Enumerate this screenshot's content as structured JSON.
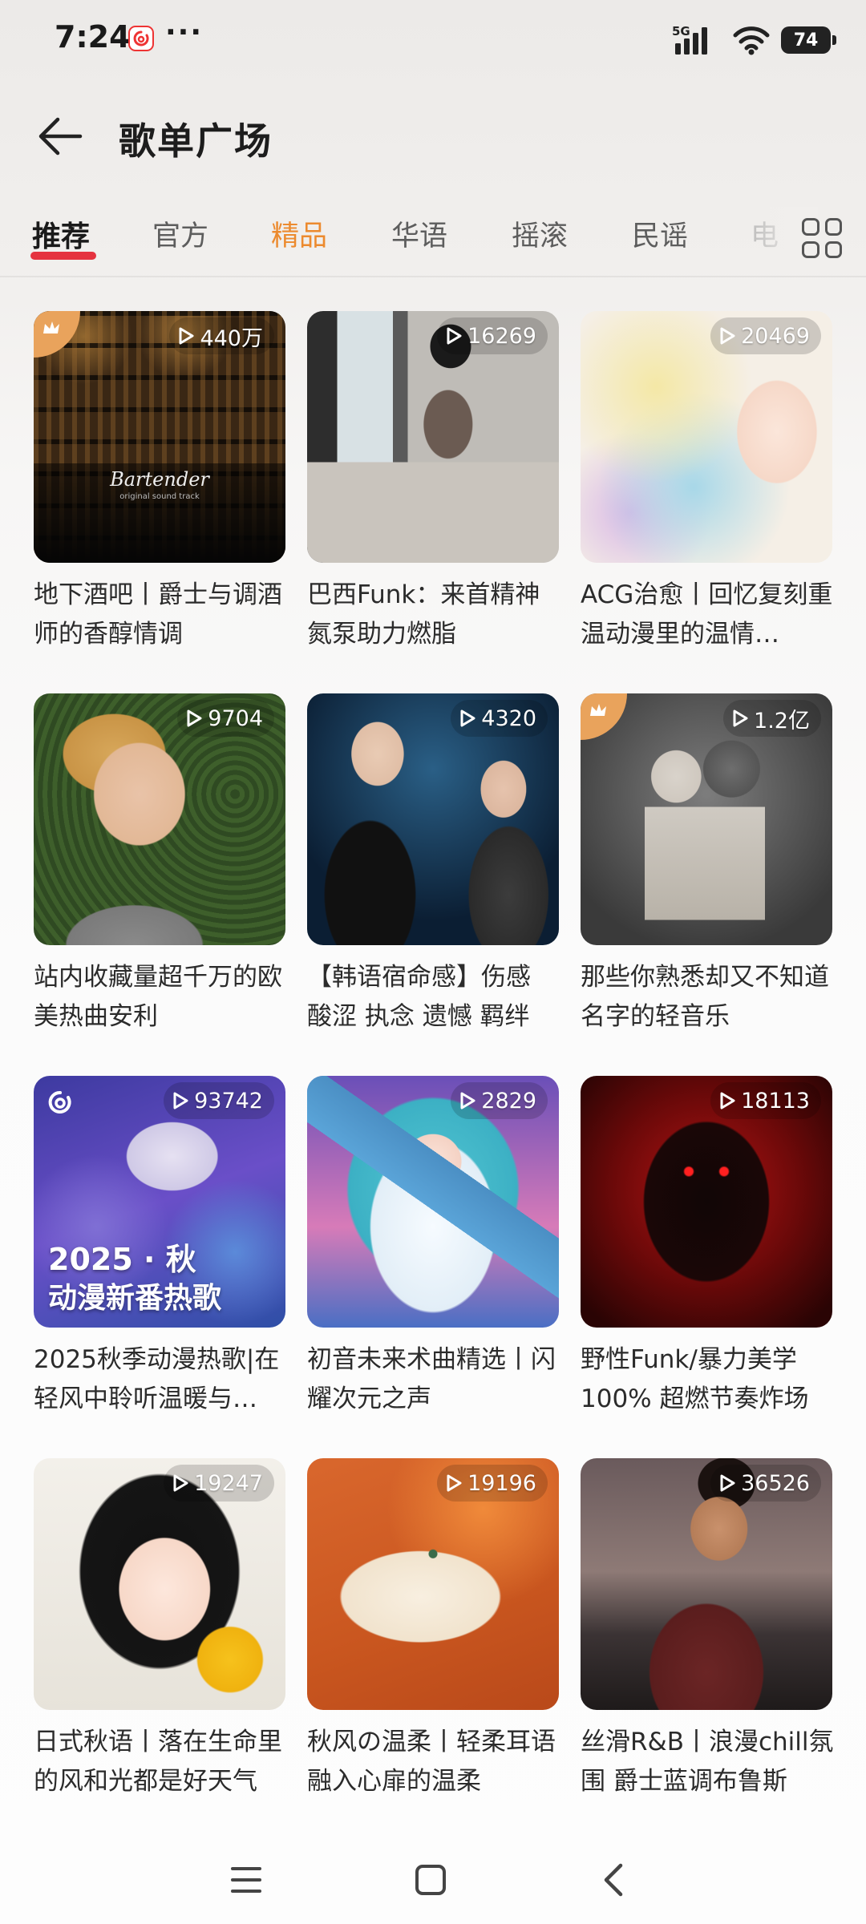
{
  "status_bar": {
    "time": "7:24",
    "more": "···",
    "network": "5G",
    "battery": "74"
  },
  "header": {
    "title": "歌单广场",
    "back_icon": "arrow-left-icon"
  },
  "tabs": [
    {
      "label": "推荐",
      "state": "selected"
    },
    {
      "label": "官方",
      "state": "normal"
    },
    {
      "label": "精品",
      "state": "highlighted"
    },
    {
      "label": "华语",
      "state": "normal"
    },
    {
      "label": "摇滚",
      "state": "normal"
    },
    {
      "label": "民谣",
      "state": "normal"
    },
    {
      "label": "电",
      "state": "faded"
    }
  ],
  "colors": {
    "accent_red": "#e5333f",
    "highlight_orange": "#ec8a2e",
    "badge_orange": "#e9a35c"
  },
  "playlists": [
    {
      "title": "地下酒吧丨爵士与调酒师的香醇情调",
      "play_count": "440万",
      "badge": "crown-icon",
      "cover_text": "Bartender",
      "cover_subtext": "original sound track"
    },
    {
      "title": "巴西Funk：来首精神氮泵助力燃脂",
      "play_count": "16269"
    },
    {
      "title": "ACG治愈丨回忆复刻重温动漫里的温情…",
      "play_count": "20469"
    },
    {
      "title": "站内收藏量超千万的欧美热曲安利",
      "play_count": "9704"
    },
    {
      "title": "【韩语宿命感】伤感 酸涩 执念 遗憾 羁绊",
      "play_count": "4320"
    },
    {
      "title": "那些你熟悉却又不知道名字的轻音乐",
      "play_count": "1.2亿",
      "badge": "crown-icon"
    },
    {
      "title": "2025秋季动漫热歌|在轻风中聆听温暖与…",
      "play_count": "93742",
      "badge": "netease-icon",
      "cover_text": "2025 · 秋",
      "cover_subtext": "动漫新番热歌"
    },
    {
      "title": "初音未来术曲精选丨闪耀次元之声",
      "play_count": "2829"
    },
    {
      "title": "野性Funk/暴力美学100% 超燃节奏炸场",
      "play_count": "18113"
    },
    {
      "title": "日式秋语丨落在生命里的风和光都是好天气",
      "play_count": "19247"
    },
    {
      "title": "秋风の温柔丨轻柔耳语融入心扉的温柔",
      "play_count": "19196"
    },
    {
      "title": "丝滑R&B丨浪漫chill氛围 爵士蓝调布鲁斯",
      "play_count": "36526"
    }
  ],
  "nav_bar": {
    "menu_icon": "menu-icon",
    "home_icon": "home-square-icon",
    "back_icon": "chevron-left-icon"
  }
}
